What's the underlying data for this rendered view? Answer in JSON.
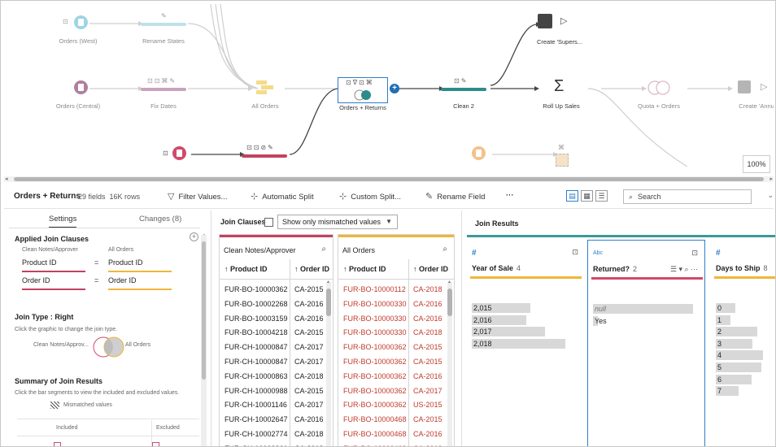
{
  "flow": {
    "nodes": [
      {
        "id": "orders-west",
        "label": "Orders (West)"
      },
      {
        "id": "rename-states",
        "label": "Rename States"
      },
      {
        "id": "orders-central",
        "label": "Orders (Central)"
      },
      {
        "id": "fix-dates",
        "label": "Fix Dates"
      },
      {
        "id": "all-orders",
        "label": "All Orders"
      },
      {
        "id": "orders-returns",
        "label": "Orders + Returns"
      },
      {
        "id": "clean-2",
        "label": "Clean 2"
      },
      {
        "id": "create-supers",
        "label": "Create 'Supers..."
      },
      {
        "id": "roll-up-sales",
        "label": "Roll Up Sales"
      },
      {
        "id": "quota-orders",
        "label": "Quota + Orders"
      },
      {
        "id": "create-annual",
        "label": "Create 'Annual"
      }
    ],
    "zoom": "100%",
    "colors": {
      "west": "#9fd4e3",
      "central": "#b17fa0",
      "returns": "#d04a6a",
      "quota": "#f3c28a",
      "join": "#2e8b8a",
      "clean": "#2e8b8a",
      "agg": "#333333"
    }
  },
  "toolbar": {
    "title": "Orders + Returns",
    "fields": "29 fields",
    "rows": "16K rows",
    "filter": "Filter Values...",
    "auto_split": "Automatic Split",
    "custom_split": "Custom Split...",
    "rename": "Rename Field",
    "more": "···",
    "search_placeholder": "Search"
  },
  "settings": {
    "tab_settings": "Settings",
    "tab_changes": "Changes (8)",
    "applied_title": "Applied Join Clauses",
    "left_source": "Clean Notes/Approver",
    "right_source": "All Orders",
    "clauses": [
      {
        "left": "Product ID",
        "op": "=",
        "right": "Product ID"
      },
      {
        "left": "Order ID",
        "op": "=",
        "right": "Order ID"
      }
    ],
    "join_type_title": "Join Type : Right",
    "join_type_hint": "Click the graphic to change the join type.",
    "venn_left": "Clean Notes/Approv...",
    "venn_right": "All Orders",
    "summary_title": "Summary of Join Results",
    "summary_hint": "Click the bar segments to view the included and excluded values.",
    "mismatched": "Mismatched values",
    "included": "Included",
    "excluded": "Excluded"
  },
  "join_clauses": {
    "title": "Join Clauses",
    "filter_label": "Show only mismatched values",
    "left_table": {
      "name": "Clean Notes/Approver",
      "col1": "↑ Product ID",
      "col2": "↑ Order ID",
      "rows": [
        [
          "FUR-BO-10000362",
          "CA-2015"
        ],
        [
          "FUR-BO-10002268",
          "CA-2016"
        ],
        [
          "FUR-BO-10003159",
          "CA-2016"
        ],
        [
          "FUR-BO-10004218",
          "CA-2015"
        ],
        [
          "FUR-CH-10000847",
          "CA-2017"
        ],
        [
          "FUR-CH-10000847",
          "CA-2017"
        ],
        [
          "FUR-CH-10000863",
          "CA-2018"
        ],
        [
          "FUR-CH-10000988",
          "CA-2015"
        ],
        [
          "FUR-CH-10001146",
          "CA-2017"
        ],
        [
          "FUR-CH-10002647",
          "CA-2016"
        ],
        [
          "FUR-CH-10002774",
          "CA-2018"
        ],
        [
          "FUR-CH-10002961",
          "CA-2018"
        ]
      ]
    },
    "right_table": {
      "name": "All Orders",
      "col1": "↑ Product ID",
      "col2": "↑ Order ID",
      "rows": [
        [
          "FUR-BO-10000112",
          "CA-2018"
        ],
        [
          "FUR-BO-10000330",
          "CA-2016"
        ],
        [
          "FUR-BO-10000330",
          "CA-2016"
        ],
        [
          "FUR-BO-10000330",
          "CA-2018"
        ],
        [
          "FUR-BO-10000362",
          "CA-2015"
        ],
        [
          "FUR-BO-10000362",
          "CA-2015"
        ],
        [
          "FUR-BO-10000362",
          "CA-2016"
        ],
        [
          "FUR-BO-10000362",
          "CA-2017"
        ],
        [
          "FUR-BO-10000362",
          "US-2015"
        ],
        [
          "FUR-BO-10000468",
          "CA-2015"
        ],
        [
          "FUR-BO-10000468",
          "CA-2016"
        ],
        [
          "FUR-BO-10000468",
          "CA-2018"
        ]
      ]
    }
  },
  "join_results": {
    "title": "Join Results",
    "fields": [
      {
        "type": "#",
        "name": "Year of Sale",
        "count": "4",
        "color": "#f0b63a",
        "values": [
          {
            "label": "2,015",
            "frac": 0.56
          },
          {
            "label": "2,016",
            "frac": 0.52
          },
          {
            "label": "2,017",
            "frac": 0.7
          },
          {
            "label": "2,018",
            "frac": 0.9
          }
        ]
      },
      {
        "type": "Abc",
        "name": "Returned?",
        "count": "2",
        "color": "#d04a6a",
        "values": [
          {
            "label": "null",
            "frac": 0.96
          },
          {
            "label": "Yes",
            "frac": 0.05
          }
        ]
      },
      {
        "type": "#",
        "name": "Days to Ship",
        "count": "8",
        "color": "#f0b63a",
        "values": [
          {
            "label": "0",
            "frac": 0.38
          },
          {
            "label": "1",
            "frac": 0.28
          },
          {
            "label": "2",
            "frac": 0.8
          },
          {
            "label": "3",
            "frac": 0.7
          },
          {
            "label": "4",
            "frac": 0.9
          },
          {
            "label": "5",
            "frac": 0.88
          },
          {
            "label": "6",
            "frac": 0.68
          },
          {
            "label": "7",
            "frac": 0.44
          }
        ]
      }
    ]
  }
}
